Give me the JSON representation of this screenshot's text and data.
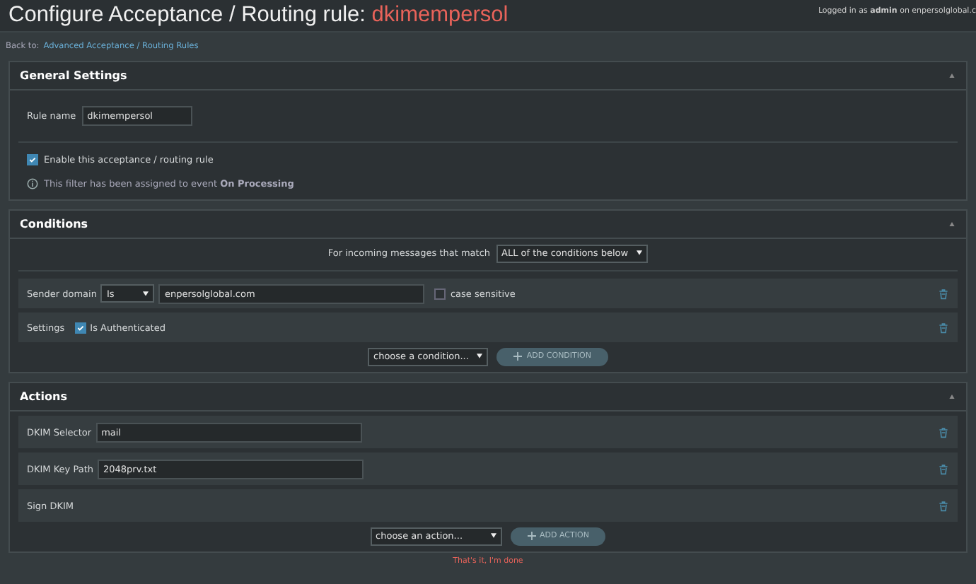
{
  "header": {
    "title": "Configure Acceptance / Routing rule:",
    "rule": "dkimempersol",
    "login": "Logged in as **admin** on enpersolglobal.c"
  },
  "breadcrumb": {
    "label": "Back to:",
    "link": "Advanced Acceptance / Routing Rules"
  },
  "general": {
    "title": "General Settings",
    "rule_name_label": "Rule name",
    "rule_name": "dkimempersol",
    "enable": {
      "label": "Enable this acceptance / routing rule",
      "checked": true
    },
    "info": "This filter has been assigned to event **On Processing**"
  },
  "conditions": {
    "title": "Conditions",
    "match_label": "For incoming messages that match",
    "match_value": "ALL of the conditions below",
    "rows": [
      {
        "kind": "text",
        "label": "Sender domain",
        "operator": "Is",
        "value": "enpersolglobal.com",
        "case_label": "case sensitive",
        "case_checked": false
      },
      {
        "kind": "checkbox",
        "label": "Settings",
        "option": "Is Authenticated",
        "checked": true
      }
    ],
    "chooser": "choose a condition...",
    "add": "ADD CONDITION"
  },
  "actions": {
    "title": "Actions",
    "rows": [
      {
        "kind": "text",
        "label": "DKIM Selector",
        "value": "mail"
      },
      {
        "kind": "text",
        "label": "DKIM Key Path",
        "value": "2048prv.txt"
      },
      {
        "kind": "plain",
        "label": "Sign DKIM"
      }
    ],
    "chooser": "choose an action...",
    "add": "ADD ACTION"
  },
  "footer": {
    "done": "That's it, I'm done"
  }
}
